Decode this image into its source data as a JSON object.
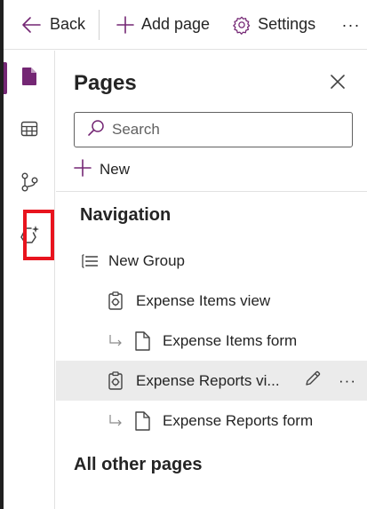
{
  "toolbar": {
    "back_label": "Back",
    "add_page_label": "Add page",
    "settings_label": "Settings",
    "more_label": "···"
  },
  "rail": {
    "items": [
      {
        "icon": "page-icon",
        "active": true
      },
      {
        "icon": "table-icon",
        "active": false
      },
      {
        "icon": "flow-icon",
        "active": false
      },
      {
        "icon": "copilot-icon",
        "active": false,
        "highlighted": true
      }
    ],
    "active_color": "#742774",
    "highlight_color": "#e8141e"
  },
  "panel": {
    "title": "Pages",
    "search_placeholder": "Search",
    "new_label": "New",
    "navigation_heading": "Navigation",
    "other_heading": "All other pages",
    "tree": [
      {
        "label": "New Group",
        "icon": "group-list-icon",
        "level": 0
      },
      {
        "label": "Expense Items view",
        "icon": "view-icon",
        "level": 1
      },
      {
        "label": "Expense Items form",
        "icon": "form-icon",
        "level": 1,
        "child": true
      },
      {
        "label": "Expense Reports vi...",
        "icon": "view-icon",
        "level": 1,
        "selected": true
      },
      {
        "label": "Expense Reports form",
        "icon": "form-icon",
        "level": 1,
        "child": true
      }
    ],
    "row_more_label": "···"
  }
}
